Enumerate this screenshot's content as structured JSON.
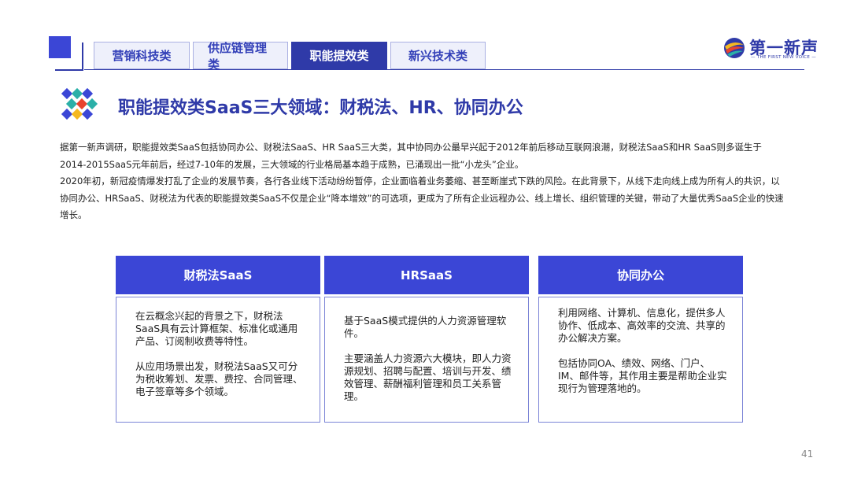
{
  "tabs": [
    {
      "label": "营销科技类",
      "active": false
    },
    {
      "label": "供应链管理类",
      "active": false
    },
    {
      "label": "职能提效类",
      "active": true
    },
    {
      "label": "新兴技术类",
      "active": false
    }
  ],
  "logo": {
    "name": "第一新声",
    "tagline": "— THE FIRST NEW VOICE —"
  },
  "page_title": "职能提效类SaaS三大领域：财税法、HR、协同办公",
  "body_paragraphs": [
    "据第一新声调研，职能提效类SaaS包括协同办公、财税法SaaS、HR SaaS三大类，其中协同办公最早兴起于2012年前后移动互联网浪潮，财税法SaaS和HR SaaS则多诞生于2014-2015SaaS元年前后，经过7-10年的发展，三大领域的行业格局基本趋于成熟，已涌现出一批“小龙头”企业。",
    "2020年初，新冠疫情爆发打乱了企业的发展节奏，各行各业线下活动纷纷暂停，企业面临着业务萎缩、甚至断崖式下跌的风险。在此背景下，从线下走向线上成为所有人的共识，以协同办公、HRSaaS、财税法为代表的职能提效类SaaS不仅是企业“降本增效”的可选项，更成为了所有企业远程办公、线上增长、组织管理的关键，带动了大量优秀SaaS企业的快速增长。"
  ],
  "columns": [
    {
      "title": "财税法SaaS",
      "paragraphs": [
        "在云概念兴起的背景之下，财税法SaaS具有云计算框架、标准化或通用产品、订阅制收费等特性。",
        "从应用场景出发，财税法SaaS又可分为税收筹划、发票、费控、合同管理、电子签章等多个领域。"
      ]
    },
    {
      "title": "HRSaaS",
      "paragraphs": [
        "基于SaaS模式提供的人力资源管理软件。",
        "主要涵盖人力资源六大模块，即人力资源规划、招聘与配置、培训与开发、绩效管理、薪酬福利管理和员工关系管理。"
      ]
    },
    {
      "title": "协同办公",
      "paragraphs": [
        "利用网络、计算机、信息化，提供多人协作、低成本、高效率的交流、共享的办公解决方案。",
        "包括协同OA、绩效、网络、门户、IM、邮件等，其作用主要是帮助企业实现行为管理落地的。"
      ]
    }
  ],
  "page_number": "41",
  "colors": {
    "primary": "#2f3aa8",
    "accent": "#3b46d6",
    "tab_bg": "#eef0fb"
  },
  "icons": {
    "title_icon": "diamond-cluster-icon",
    "logo_icon": "swirl-logo-icon"
  }
}
